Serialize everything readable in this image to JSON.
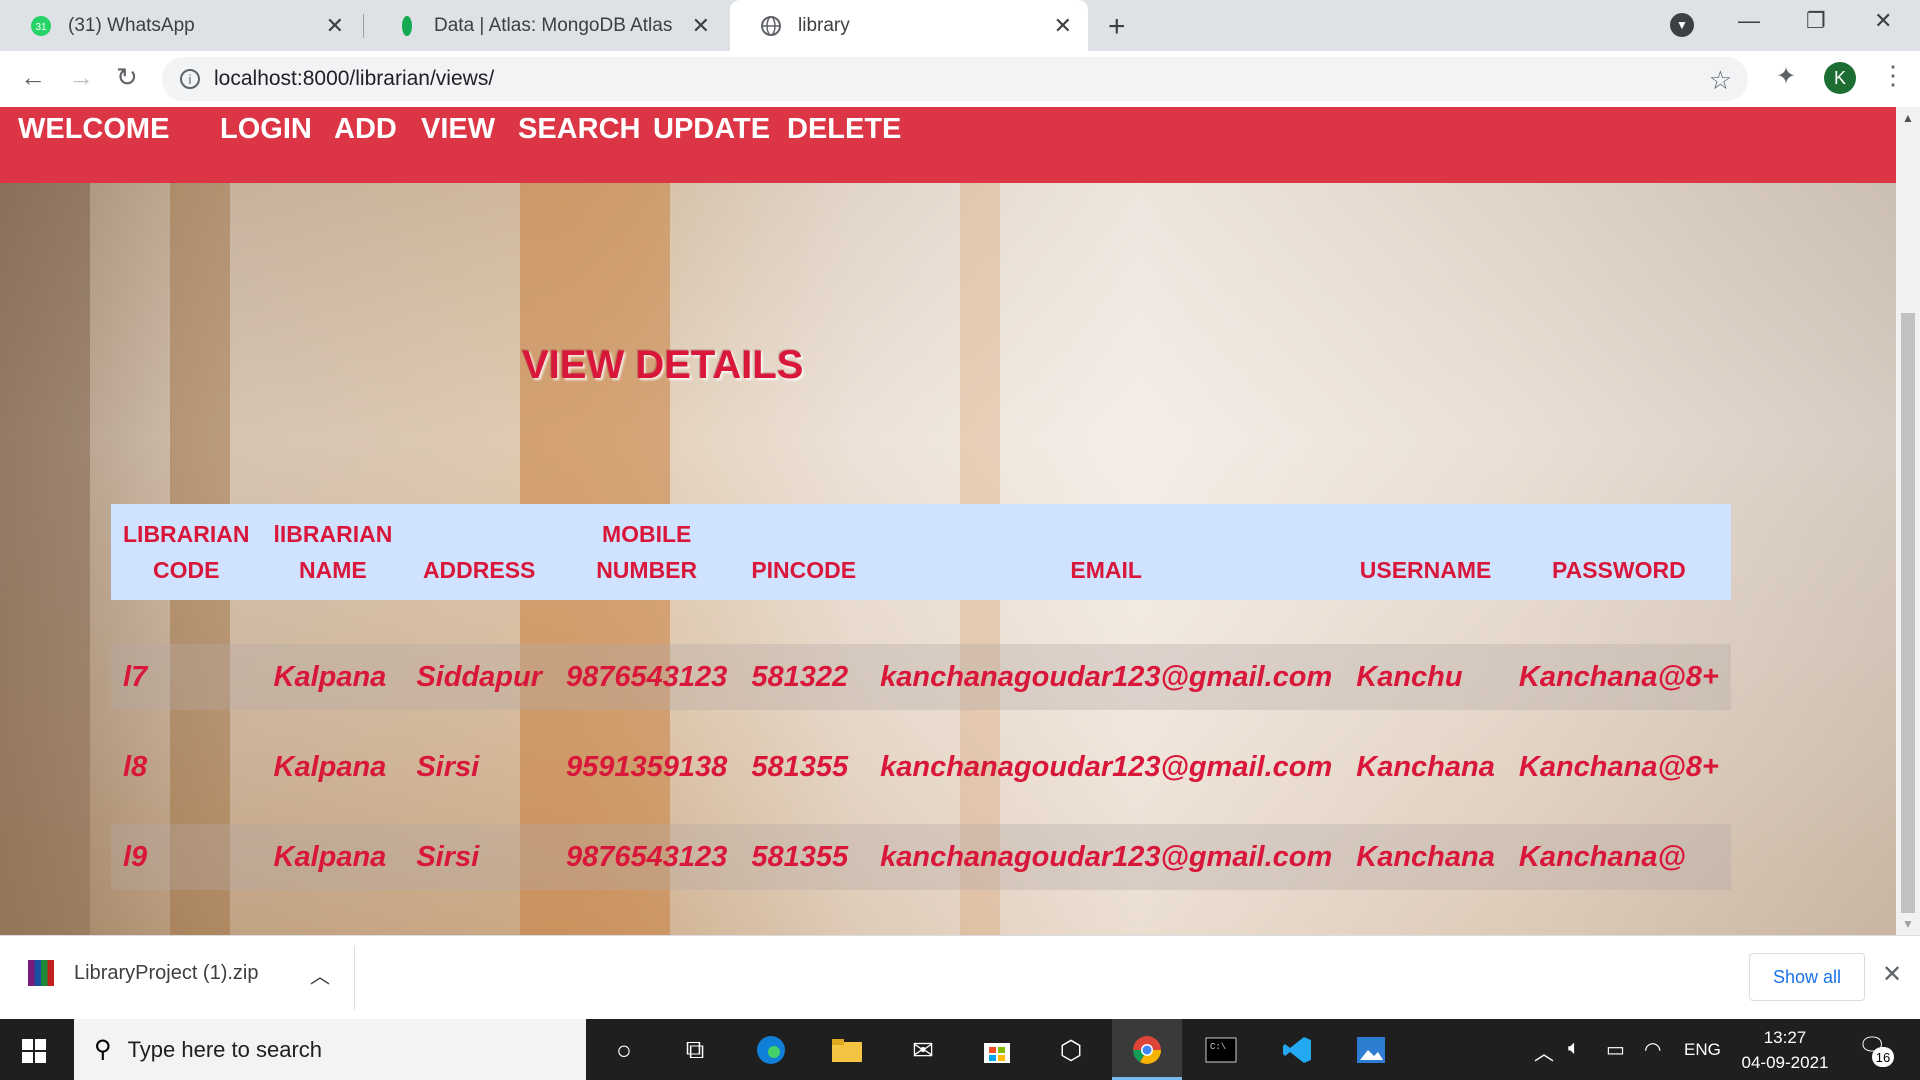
{
  "browser": {
    "tabs": [
      {
        "label": "(31) WhatsApp",
        "icon": "whatsapp-icon",
        "badge": "31"
      },
      {
        "label": "Data | Atlas: MongoDB Atlas",
        "icon": "mongodb-leaf-icon"
      },
      {
        "label": "library",
        "icon": "globe-icon",
        "active": true
      }
    ],
    "url": "localhost:8000/librarian/views/",
    "profile_initial": "K"
  },
  "navbar": {
    "brand": "WELCOME",
    "links": [
      "LOGIN",
      "ADD",
      "VIEW",
      "SEARCH",
      "UPDATE",
      "DELETE"
    ],
    "background": "#dc3545"
  },
  "page": {
    "heading": "VIEW DETAILS",
    "accent": "#d9173a",
    "header_bg": "#cfe2ff"
  },
  "table": {
    "headers": [
      [
        "LIBRARIAN",
        "CODE"
      ],
      [
        "lIBRARIAN",
        "NAME"
      ],
      [
        "",
        "ADDRESS"
      ],
      [
        "MOBILE",
        "NUMBER"
      ],
      [
        "",
        "PINCODE"
      ],
      [
        "",
        "EMAIL"
      ],
      [
        "",
        "USERNAME"
      ],
      [
        "",
        "PASSWORD"
      ]
    ],
    "rows": [
      [
        "l7",
        "Kalpana",
        "Siddapur",
        "9876543123",
        "581322",
        "kanchanagoudar123@gmail.com",
        "Kanchu",
        "Kanchana@8+"
      ],
      [
        "l8",
        "Kalpana",
        "Sirsi",
        "9591359138",
        "581355",
        "kanchanagoudar123@gmail.com",
        "Kanchana",
        "Kanchana@8+"
      ],
      [
        "l9",
        "Kalpana",
        "Sirsi",
        "9876543123",
        "581355",
        "kanchanagoudar123@gmail.com",
        "Kanchana",
        "Kanchana@"
      ]
    ]
  },
  "downloads": {
    "file": "LibraryProject (1).zip",
    "show_all": "Show all"
  },
  "taskbar": {
    "search_placeholder": "Type here to search",
    "lang": "ENG",
    "time": "13:27",
    "date": "04-09-2021",
    "notification_count": "16"
  }
}
